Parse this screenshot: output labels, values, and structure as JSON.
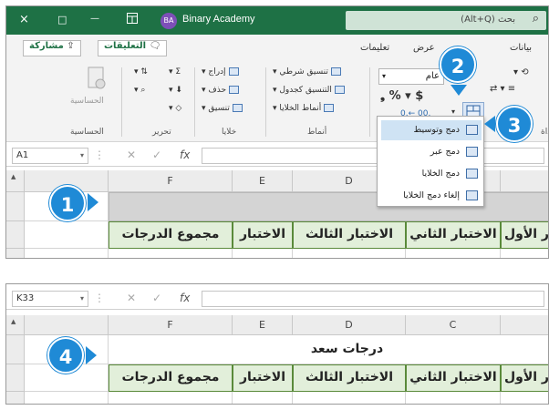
{
  "titlebar": {
    "close_glyph": "×",
    "restore_glyph": "□",
    "minimize_glyph": "—",
    "avatar_initials": "BA",
    "account_name": "Binary Academy",
    "search_placeholder": "بحث (Alt+Q)"
  },
  "tabs": {
    "share_label": "مشاركة",
    "comments_label": "التعليقات",
    "tab_help": "تعليمات",
    "tab_view": "عرض",
    "tab_data": "بيانات"
  },
  "ribbon": {
    "sensitivity_label": "الحساسية",
    "sensitivity_group": "الحساسية",
    "editing_group": "تحرير",
    "cells_group": "خلايا",
    "styles_group": "أنماط",
    "insert_label": "إدراج",
    "delete_label": "حذف",
    "format_label": "تنسيق",
    "conditional_label": "تنسيق شرطي",
    "table_label": "التنسيق كجدول",
    "cell_styles_label": "أنماط الخلايا",
    "number_format_value": "عام",
    "alignment_group": "محاذاة"
  },
  "merge_menu": {
    "items": [
      "دمج وتوسيط",
      "دمج عبر",
      "دمج الخلايا",
      "إلغاء دمج الخلايا"
    ]
  },
  "badges": {
    "b1": "1",
    "b2": "2",
    "b3": "3",
    "b4": "4"
  },
  "formula_bar_top": {
    "name_box": "A1",
    "fx": "fx"
  },
  "formula_bar_bottom": {
    "name_box": "K33",
    "fx": "fx"
  },
  "grid_top": {
    "columns": [
      "F",
      "E",
      "D",
      "C"
    ],
    "headers": [
      "مجموع الدرجات",
      "الاختبار",
      "الاختبار الثالث",
      "الاختبار الثاني",
      "الاختبار الأول"
    ]
  },
  "grid_bottom": {
    "columns": [
      "F",
      "E",
      "D",
      "C"
    ],
    "title": "درجات سعد",
    "headers": [
      "مجموع الدرجات",
      "الاختبار",
      "الاختبار الثالث",
      "الاختبار الثاني",
      "الاختبار الأول"
    ]
  },
  "colors": {
    "excel_green": "#1e7145",
    "badge_blue": "#1f8ad6",
    "header_fill": "#e2efda",
    "selected_menu": "#cfe3f4"
  }
}
